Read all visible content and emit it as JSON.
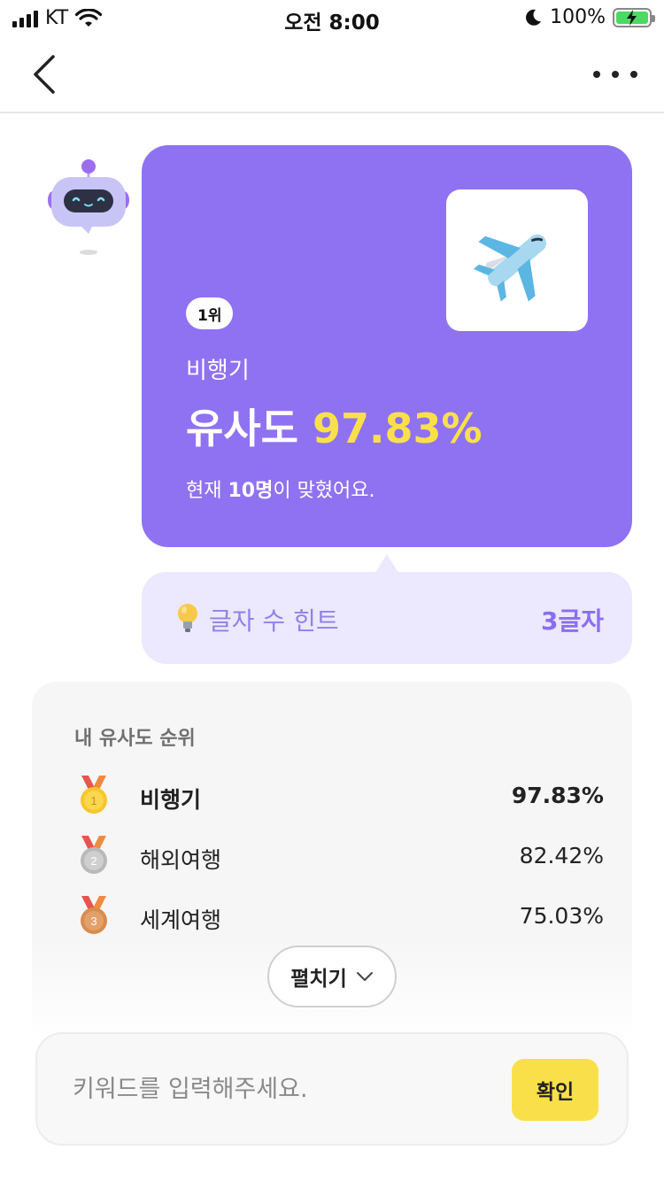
{
  "status_bar": {
    "carrier": "KT",
    "time": "오전 8:00",
    "battery_percent": "100%",
    "battery_level": 1.0,
    "icons": [
      "signal-icon",
      "wifi-icon",
      "moon-icon",
      "battery-charging-icon"
    ]
  },
  "nav": {
    "back_icon": "chevron-left-icon",
    "more_icon": "more-horizontal-icon"
  },
  "answer_card": {
    "avatar_icon": "robot-icon",
    "image_icon": "airplane-icon",
    "rank_badge": "1위",
    "word": "비행기",
    "similarity_prefix": "유사도 ",
    "similarity_value": "97.83%",
    "solvers_prefix": "현재 ",
    "solvers_count": "10명",
    "solvers_suffix": "이 맞혔어요.",
    "background_color": "#8f72f2",
    "highlight_color": "#f9e04b"
  },
  "hint": {
    "icon": "lightbulb-icon",
    "label": "글자 수 힌트",
    "value": "3글자"
  },
  "ranking": {
    "title": "내 유사도 순위",
    "items": [
      {
        "medal": "gold-medal-icon",
        "medal_number": "1",
        "word": "비행기",
        "similarity": "97.83%"
      },
      {
        "medal": "silver-medal-icon",
        "medal_number": "2",
        "word": "해외여행",
        "similarity": "82.42%"
      },
      {
        "medal": "bronze-medal-icon",
        "medal_number": "3",
        "word": "세계여행",
        "similarity": "75.03%"
      }
    ],
    "expand_label": "펼치기",
    "expand_icon": "chevron-down-icon"
  },
  "input": {
    "placeholder": "키워드를 입력해주세요.",
    "value": "",
    "submit_label": "확인"
  }
}
